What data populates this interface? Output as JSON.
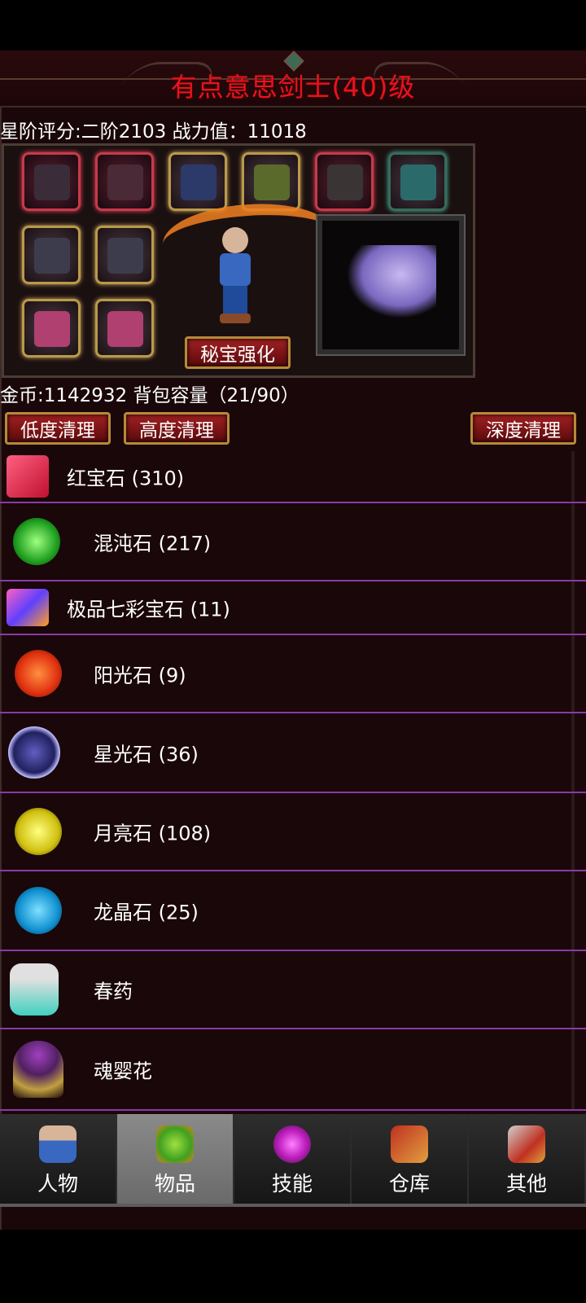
{
  "header": {
    "title": "有点意思剑士(40)级"
  },
  "stats": {
    "rating_line": "星阶评分:二阶2103 战力值：11018"
  },
  "equipment": {
    "enhance_button": "秘宝强化"
  },
  "inventory": {
    "gold_line": "金币:1142932 背包容量（21/90）",
    "clean_low": "低度清理",
    "clean_high": "高度清理",
    "clean_deep": "深度清理",
    "items": [
      {
        "name": "红宝石 (310)",
        "icon": "ruby-icon"
      },
      {
        "name": "混沌石 (217)",
        "icon": "chaos-stone-icon"
      },
      {
        "name": "极品七彩宝石 (11)",
        "icon": "rainbow-gem-icon"
      },
      {
        "name": "阳光石 (9)",
        "icon": "sunlight-stone-icon"
      },
      {
        "name": "星光石 (36)",
        "icon": "starlight-stone-icon"
      },
      {
        "name": "月亮石 (108)",
        "icon": "moon-stone-icon"
      },
      {
        "name": "龙晶石 (25)",
        "icon": "dragon-crystal-icon"
      },
      {
        "name": "春药",
        "icon": "potion-bottle-icon"
      },
      {
        "name": "魂婴花",
        "icon": "soul-flower-icon"
      }
    ]
  },
  "nav": {
    "tabs": [
      {
        "label": "人物",
        "icon": "character-icon"
      },
      {
        "label": "物品",
        "icon": "items-icon"
      },
      {
        "label": "技能",
        "icon": "skills-icon"
      },
      {
        "label": "仓库",
        "icon": "warehouse-icon"
      },
      {
        "label": "其他",
        "icon": "other-icon"
      }
    ],
    "active_index": 1
  },
  "colors": {
    "title_red": "#e8131e",
    "list_divider": "#8a3aa8",
    "panel_bg": "#1a0709"
  }
}
